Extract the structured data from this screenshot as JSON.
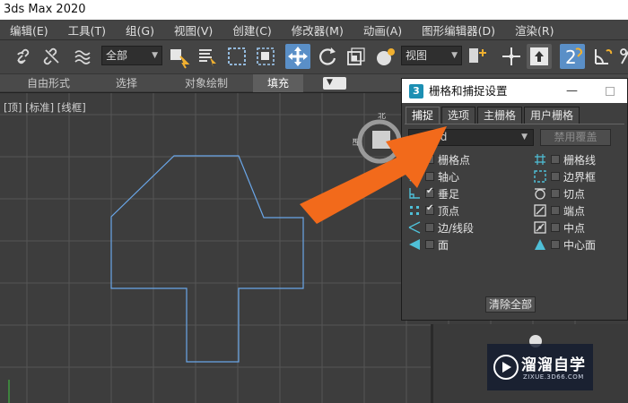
{
  "app": {
    "title": "3ds Max 2020"
  },
  "menu": [
    "编辑(E)",
    "工具(T)",
    "组(G)",
    "视图(V)",
    "创建(C)",
    "修改器(M)",
    "动画(A)",
    "图形编辑器(D)",
    "渲染(R)"
  ],
  "toolbar": {
    "selection_filter": "全部",
    "ref_coord": "视图",
    "snap_label": "2",
    "active_tools": [
      "select-and-move",
      "snap-2d"
    ]
  },
  "ribbon": {
    "tabs": [
      "自由形式",
      "选择",
      "对象绘制",
      "填充"
    ],
    "selected": "填充"
  },
  "viewport": {
    "label": "[顶] [标准] [线框]",
    "viewcube_labels": [
      "北",
      "西"
    ]
  },
  "dialog": {
    "title": "栅格和捕捉设置",
    "tabs": [
      "捕捉",
      "选项",
      "主栅格",
      "用户栅格"
    ],
    "selected_tab": "捕捉",
    "mode_select": "rd",
    "override_button": "禁用覆盖",
    "clear_button": "清除全部",
    "left_items": [
      {
        "label": "栅格点",
        "checked": false,
        "icon": "grid-point-icon"
      },
      {
        "label": "轴心",
        "checked": false,
        "icon": "pivot-icon"
      },
      {
        "label": "垂足",
        "checked": true,
        "icon": "perpendicular-icon"
      },
      {
        "label": "顶点",
        "checked": true,
        "icon": "vertex-icon"
      },
      {
        "label": "边/线段",
        "checked": false,
        "icon": "edge-icon"
      },
      {
        "label": "面",
        "checked": false,
        "icon": "face-icon"
      }
    ],
    "right_items": [
      {
        "label": "栅格线",
        "checked": false,
        "icon": "grid-line-icon"
      },
      {
        "label": "边界框",
        "checked": false,
        "icon": "bounding-box-icon"
      },
      {
        "label": "切点",
        "checked": false,
        "icon": "tangent-icon"
      },
      {
        "label": "端点",
        "checked": false,
        "icon": "endpoint-icon"
      },
      {
        "label": "中点",
        "checked": false,
        "icon": "midpoint-icon"
      },
      {
        "label": "中心面",
        "checked": false,
        "icon": "center-face-icon"
      }
    ]
  },
  "watermark": {
    "text": "溜溜自学",
    "url": "ZIXUE.3D66.COM"
  },
  "colors": {
    "active_blue": "#5a8fc7",
    "annotation_orange": "#f26a1b",
    "shape_line": "#6aa6e8",
    "viewport_bg": "#3d3d3d"
  }
}
